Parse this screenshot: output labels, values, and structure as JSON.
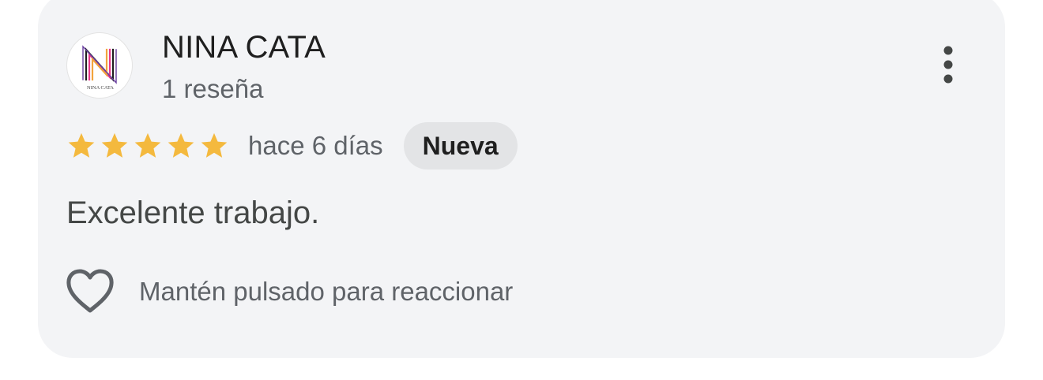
{
  "review": {
    "author": {
      "name": "NINA CATA",
      "review_count": "1 reseña",
      "avatar": {
        "monogram": "N",
        "caption": "NINA CATA"
      }
    },
    "rating": 5,
    "max_rating": 5,
    "date": "hace 6 días",
    "badge": "Nueva",
    "text": "Excelente trabajo.",
    "reaction_hint": "Mantén pulsado para reaccionar"
  },
  "icons": {
    "star": "star-icon",
    "more": "more-vert-icon",
    "heart": "heart-outline-icon"
  },
  "colors": {
    "card_background": "#f3f4f6",
    "star": "#f4b93e",
    "badge_background": "#e3e4e6",
    "secondary_text": "#5f6368",
    "logo_pink": "#e8388a",
    "logo_orange": "#f2a33c",
    "logo_purple": "#6a3fa0"
  }
}
